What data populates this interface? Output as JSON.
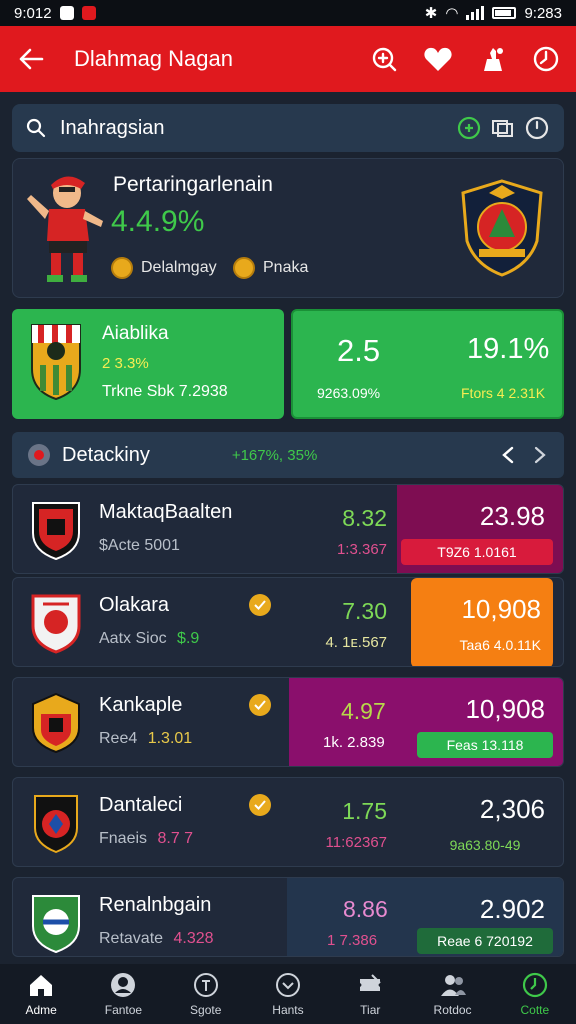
{
  "status_bar": {
    "time_left": "9:012",
    "time_right": "9:283"
  },
  "app_bar": {
    "title": "Dlahmag Nagan",
    "icons": [
      "back-arrow-icon",
      "search-plus-icon",
      "heart-icon",
      "share-icon",
      "clock-icon"
    ]
  },
  "search": {
    "label": "Inahragsian"
  },
  "hero": {
    "title": "Pertaringarlenain",
    "percent": "4.4.9%",
    "chips": [
      {
        "label": "Delalmgay"
      },
      {
        "label": "Pnaka"
      }
    ]
  },
  "promo": {
    "left": {
      "title": "Aiablika",
      "odds": "2 3.3%",
      "sub": "Trkne Sbk 7.2938"
    },
    "right": {
      "value1": "2.5",
      "value2": "19.1%",
      "sub1": "9263.09%",
      "sub2": "Ftors 4 2.31K"
    }
  },
  "section": {
    "title": "Detackiny",
    "delta": "+167%, 35%"
  },
  "matches": [
    {
      "name": "MaktaqBaalten",
      "sub_label": "$Acte 5001",
      "sub_value": "",
      "verified": false,
      "odd": "8.32",
      "odd_sub": "1:3.367",
      "right_value": "23.98",
      "right_sub": "T9Z6 1.0161",
      "right_color": "#7e0d52",
      "pill_color": "#d81b3c"
    },
    {
      "name": "Olakara",
      "sub_label": "Aatx Sioc",
      "sub_value": "$.9",
      "verified": true,
      "odd": "7.30",
      "odd_sub": "4. 1ᴇ.567",
      "right_value": "10,908",
      "right_sub": "Taa6 4.0.11K",
      "right_color": "#f57f12",
      "pill_color": ""
    },
    {
      "name": "Kankaple",
      "sub_label": "Ree4",
      "sub_value": "1.3.01",
      "verified": true,
      "odd": "4.97",
      "odd_sub": "1k. 2.839",
      "right_value": "10,908",
      "right_sub": "Feas 13.118",
      "right_color": "#8a0f6c",
      "pill_color": "#2cb54f"
    },
    {
      "name": "Dantaleci",
      "sub_label": "Fnaeis",
      "sub_value": "8.7  7",
      "verified": true,
      "odd": "1.75",
      "odd_sub": "11:62367",
      "right_value": "2,306",
      "right_sub": "9a63.80-49",
      "right_color": "",
      "pill_color": ""
    },
    {
      "name": "Renalnbgain",
      "sub_label": "Retavate",
      "sub_value": "4.328",
      "verified": false,
      "odd": "8.86",
      "odd_sub": "1  7.386",
      "right_value": "2.902",
      "right_sub": "Reae 6 720192",
      "right_color": "#23354d",
      "pill_color": "#1f6b3a"
    }
  ],
  "bottom_nav": [
    {
      "label": "Adme",
      "icon": "home-icon"
    },
    {
      "label": "Fantoe",
      "icon": "profile-icon"
    },
    {
      "label": "Sgote",
      "icon": "sport-icon"
    },
    {
      "label": "Hants",
      "icon": "chevron-circle-icon"
    },
    {
      "label": "Tiar",
      "icon": "ticket-icon"
    },
    {
      "label": "Rotdoc",
      "icon": "users-icon"
    },
    {
      "label": "Cotte",
      "icon": "live-clock-icon"
    }
  ],
  "colors": {
    "brand_red": "#e0191e",
    "accent_green": "#2cb54f",
    "bg_dark": "#1b2330",
    "card": "#20293a",
    "highlight_green": "#3fc94a",
    "gold": "#e8a91c"
  }
}
